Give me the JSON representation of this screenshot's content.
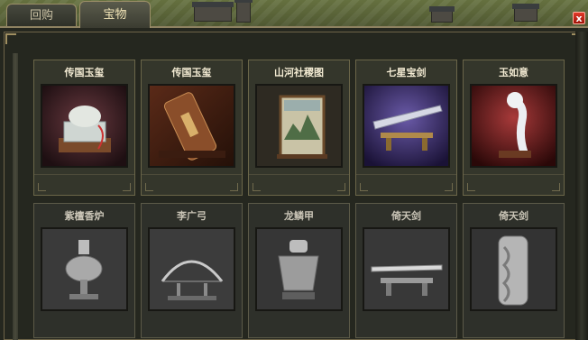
{
  "tabs": [
    {
      "label": "回购",
      "active": false
    },
    {
      "label": "宝物",
      "active": true
    }
  ],
  "close_label": "x",
  "items": [
    {
      "name": "传国玉玺",
      "owned": true,
      "icon": "jade-seal-icon"
    },
    {
      "name": "传国玉玺",
      "owned": true,
      "icon": "scroll-case-icon"
    },
    {
      "name": "山河社稷图",
      "owned": true,
      "icon": "landscape-scroll-icon"
    },
    {
      "name": "七星宝剑",
      "owned": true,
      "icon": "sword-on-stand-icon"
    },
    {
      "name": "玉如意",
      "owned": true,
      "icon": "ruyi-scepter-icon"
    },
    {
      "name": "紫檀香炉",
      "owned": false,
      "icon": "incense-burner-icon"
    },
    {
      "name": "李广弓",
      "owned": false,
      "icon": "bow-on-rack-icon"
    },
    {
      "name": "龙鳞甲",
      "owned": false,
      "icon": "dragon-armor-icon"
    },
    {
      "name": "倚天剑",
      "owned": false,
      "icon": "sword-on-stand-icon"
    },
    {
      "name": "倚天剑",
      "owned": false,
      "icon": "dragon-pillar-icon"
    }
  ],
  "colors": {
    "panel": "#25271f",
    "frame": "#8e8261",
    "active_title": "#f2ead2",
    "inactive_title": "#c9c4b6"
  }
}
